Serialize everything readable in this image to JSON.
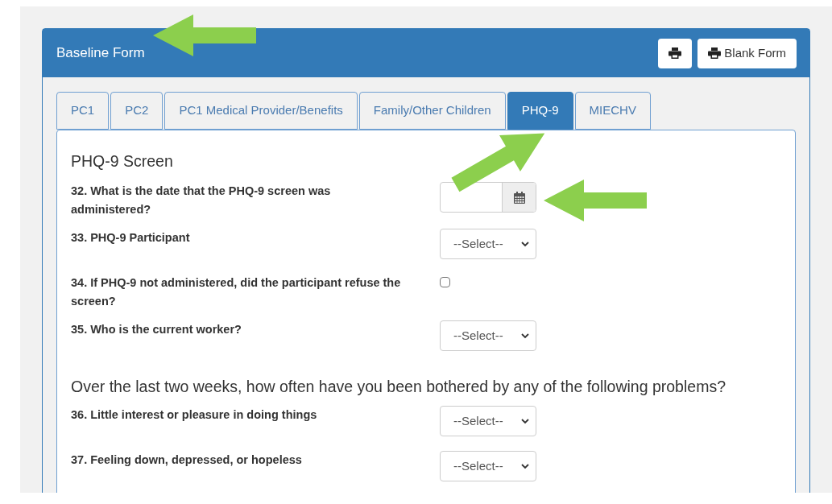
{
  "panel": {
    "title": "Baseline Form",
    "buttons": [
      {
        "kind": "print"
      },
      {
        "kind": "print",
        "label": "Blank Form"
      }
    ]
  },
  "tabs": [
    {
      "label": "PC1",
      "selected": false
    },
    {
      "label": "PC2",
      "selected": false
    },
    {
      "label": "PC1 Medical Provider/Benefits",
      "selected": false
    },
    {
      "label": "Family/Other Children",
      "selected": false
    },
    {
      "label": "PHQ-9",
      "selected": true
    },
    {
      "label": "MIECHV",
      "selected": false
    }
  ],
  "sections": [
    {
      "heading": "PHQ-9 Screen",
      "questions": [
        {
          "kind": "date",
          "label": "32. What is the date that the PHQ-9 screen was administered?"
        },
        {
          "kind": "select",
          "label": "33. PHQ-9 Participant",
          "value": "--Select--"
        },
        {
          "kind": "checkbox",
          "label": "34. If PHQ-9 not administered, did the participant refuse the screen?",
          "checked": false
        },
        {
          "kind": "select",
          "label": "35. Who is the current worker?",
          "value": "--Select--"
        }
      ]
    },
    {
      "heading": "Over the last two weeks, how often have you been bothered by any of the following problems?",
      "questions": [
        {
          "kind": "select",
          "label": "36. Little interest or pleasure in doing things",
          "value": "--Select--"
        },
        {
          "kind": "select",
          "label": "37. Feeling down, depressed, or hopeless",
          "value": "--Select--"
        }
      ]
    }
  ]
}
